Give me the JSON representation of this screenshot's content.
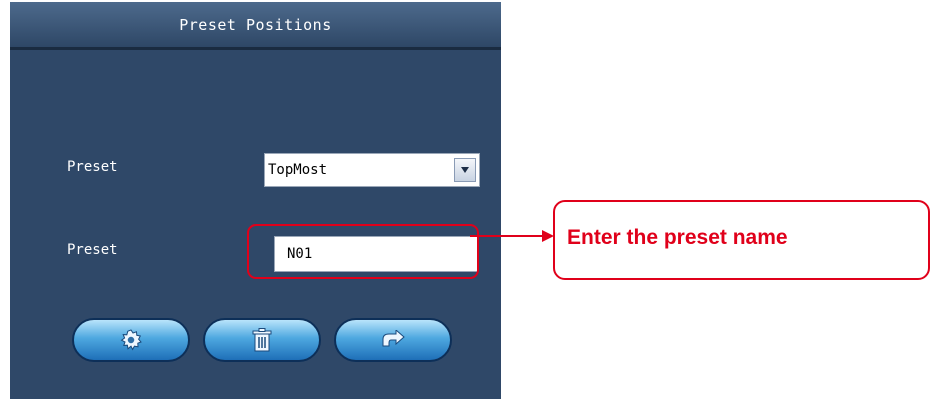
{
  "window": {
    "title": "Preset Positions"
  },
  "preset_select": {
    "label": "Preset",
    "value": "TopMost"
  },
  "preset_name": {
    "label": "Preset",
    "value": "N01"
  },
  "buttons": [
    {
      "icon": "gear-icon"
    },
    {
      "icon": "trash-icon"
    },
    {
      "icon": "goto-icon"
    }
  ],
  "annotation": {
    "text": "Enter the preset name",
    "color": "#e0001a"
  },
  "colors": {
    "panel_bg": "#2f4868",
    "button_accent": "#4ea8e0"
  }
}
